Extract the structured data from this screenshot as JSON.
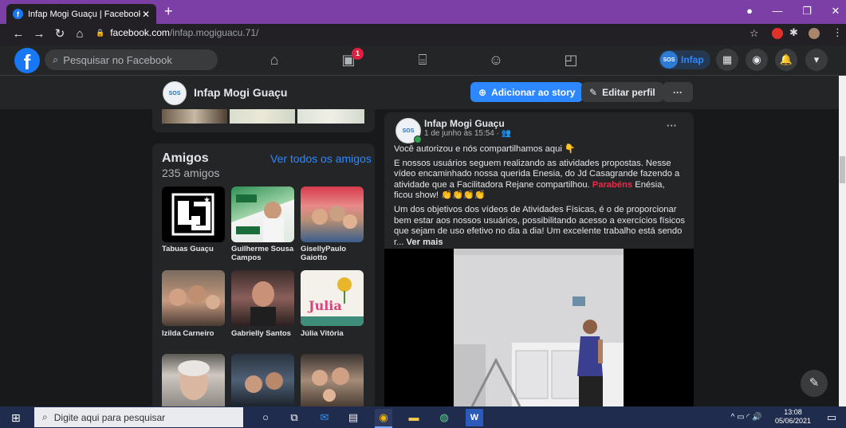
{
  "browser": {
    "tab_title": "Infap Mogi Guaçu | Facebook",
    "tab_close": "✕",
    "new_tab": "+",
    "url_domain": "facebook.com",
    "url_path": "/infap.mogiguacu.71/"
  },
  "fb_header": {
    "logo": "f",
    "search_placeholder": "Pesquisar no Facebook",
    "video_badge": "1",
    "profile_short": "Infap"
  },
  "profile_bar": {
    "name": "Infap Mogi Guaçu",
    "add_story": "Adicionar ao story",
    "edit_profile": "Editar perfil",
    "more": "···"
  },
  "friends": {
    "title": "Amigos",
    "see_all": "Ver todos os amigos",
    "count": "235 amigos",
    "items": [
      {
        "name": "Tabuas Guaçu"
      },
      {
        "name": "Guilherme Sousa Campos"
      },
      {
        "name": "GisellyPaulo Gaiotto"
      },
      {
        "name": "Izilda Carneiro"
      },
      {
        "name": "Gabrielly Santos"
      },
      {
        "name": "Júlia Vitória"
      }
    ]
  },
  "post": {
    "author": "Infap Mogi Guaçu",
    "meta": "1 de junho às 15:54 · ",
    "menu": "···",
    "line1": "Você autorizou e nós compartilhamos aqui 👇",
    "line2a": "E nossos usuários seguem realizando as atividades propostas. Nesse vídeo encaminhado nossa querida Enesia, do Jd Casagrande fazendo a atividade que a Facilitadora Rejane compartilhou. ",
    "highlight": "Parabéns",
    "line2b": " Enésia, ficou show! 👏👏👏👏",
    "line3": "Um dos objetivos dos vídeos de Atividades Físicas, é o de proporcionar bem estar aos nossos usuários, possibilitando acesso a exercícios físicos que sejam de uso efetivo no dia a dia! Um excelente trabalho está sendo r... ",
    "see_more": "Ver mais"
  },
  "taskbar": {
    "search_placeholder": "Digite aqui para pesquisar",
    "time": "13:08",
    "date": "05/06/2021"
  },
  "colors": {
    "tab_strip": "#7b3fa6",
    "fb_blue": "#2d88ff",
    "bg": "#18191a",
    "card": "#242526",
    "highlight": "#f02849"
  }
}
